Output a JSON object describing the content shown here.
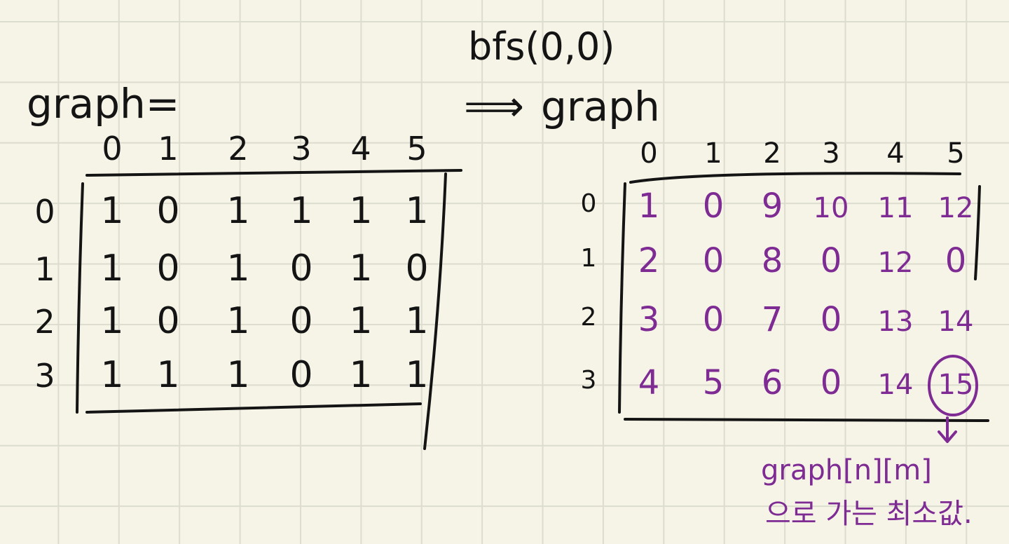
{
  "labels": {
    "graph_left": "graph=",
    "bfs_call": "bfs(0,0)",
    "arrow": "⟹",
    "graph_right": "graph",
    "note_line1": "graph[n][m]",
    "note_line2": "으로 가는 최소값."
  },
  "left_matrix": {
    "col_headers": [
      "0",
      "1",
      "2",
      "3",
      "4",
      "5"
    ],
    "row_headers": [
      "0",
      "1",
      "2",
      "3"
    ],
    "rows": [
      [
        "1",
        "0",
        "1",
        "1",
        "1",
        "1"
      ],
      [
        "1",
        "0",
        "1",
        "0",
        "1",
        "0"
      ],
      [
        "1",
        "0",
        "1",
        "0",
        "1",
        "1"
      ],
      [
        "1",
        "1",
        "1",
        "0",
        "1",
        "1"
      ]
    ]
  },
  "right_matrix": {
    "col_headers": [
      "0",
      "1",
      "2",
      "3",
      "4",
      "5"
    ],
    "row_headers": [
      "0",
      "1",
      "2",
      "3"
    ],
    "rows": [
      [
        "1",
        "0",
        "9",
        "10",
        "11",
        "12"
      ],
      [
        "2",
        "0",
        "8",
        "0",
        "12",
        "0"
      ],
      [
        "3",
        "0",
        "7",
        "0",
        "13",
        "14"
      ],
      [
        "4",
        "5",
        "6",
        "0",
        "14",
        "15"
      ]
    ],
    "highlight": {
      "row": 3,
      "col": 5
    }
  },
  "colors": {
    "ink": "#141414",
    "highlight_ink": "#7e2b93",
    "paper": "#f6f3e7",
    "grid": "#dcdccf"
  }
}
